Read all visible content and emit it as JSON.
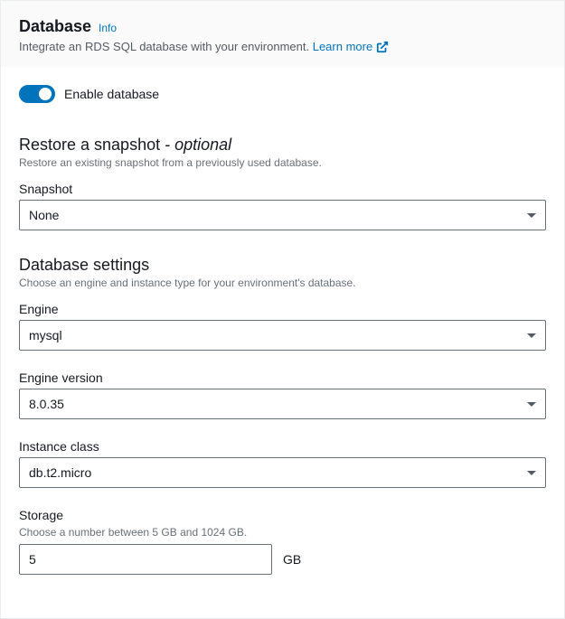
{
  "header": {
    "title": "Database",
    "info": "Info",
    "description": "Integrate an RDS SQL database with your environment.",
    "learn_more": "Learn more"
  },
  "toggle": {
    "label": "Enable database",
    "on": true
  },
  "restore": {
    "title": "Restore a snapshot",
    "optional": "- optional",
    "description": "Restore an existing snapshot from a previously used database.",
    "snapshot_label": "Snapshot",
    "snapshot_value": "None"
  },
  "settings": {
    "title": "Database settings",
    "description": "Choose an engine and instance type for your environment's database.",
    "engine_label": "Engine",
    "engine_value": "mysql",
    "engine_version_label": "Engine version",
    "engine_version_value": "8.0.35",
    "instance_class_label": "Instance class",
    "instance_class_value": "db.t2.micro",
    "storage_label": "Storage",
    "storage_hint": "Choose a number between 5 GB and 1024 GB.",
    "storage_value": "5",
    "storage_unit": "GB"
  }
}
